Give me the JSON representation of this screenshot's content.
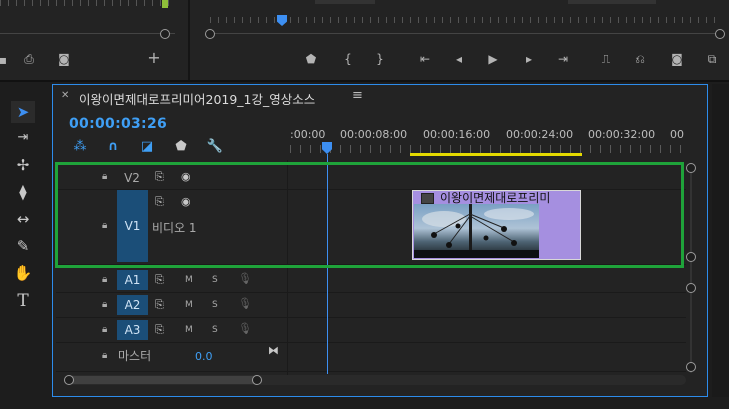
{
  "sequence": {
    "title": "이왕이면제대로프리미어2019_1강_영상소스",
    "timecode": "00:00:03:26"
  },
  "ruler": {
    "labels": [
      ":00:00",
      "00:00:08:00",
      "00:00:16:00",
      "00:00:24:00",
      "00:00:32:00",
      "00"
    ]
  },
  "video_tracks": [
    {
      "id": "V2",
      "name": ""
    },
    {
      "id": "V1",
      "name": "비디오 1"
    }
  ],
  "audio_tracks": [
    {
      "id": "A1",
      "m": "M",
      "s": "S"
    },
    {
      "id": "A2",
      "m": "M",
      "s": "S"
    },
    {
      "id": "A3",
      "m": "M",
      "s": "S"
    }
  ],
  "master": {
    "label": "마스터",
    "value": "0.0"
  },
  "clip": {
    "title": "이왕이면제대로프리미"
  },
  "icons": {
    "source_controls": [
      "marker-icon",
      "camera-icon",
      "add-icon"
    ],
    "program_controls": [
      "marker-icon",
      "mark-in-icon",
      "mark-out-icon",
      "go-to-in-icon",
      "step-back-icon",
      "play-icon",
      "step-forward-icon",
      "go-to-out-icon",
      "lift-icon",
      "extract-icon",
      "export-frame-icon",
      "comparison-icon"
    ],
    "tools": [
      "selection-tool-icon",
      "track-select-tool-icon",
      "ripple-edit-tool-icon",
      "razor-tool-icon",
      "slip-tool-icon",
      "pen-tool-icon",
      "hand-tool-icon",
      "type-tool-icon"
    ]
  },
  "colors": {
    "accent": "#2d8ceb",
    "highlight": "#1fa33a",
    "clip": "#a58fe0",
    "work_area": "#e5da00"
  }
}
